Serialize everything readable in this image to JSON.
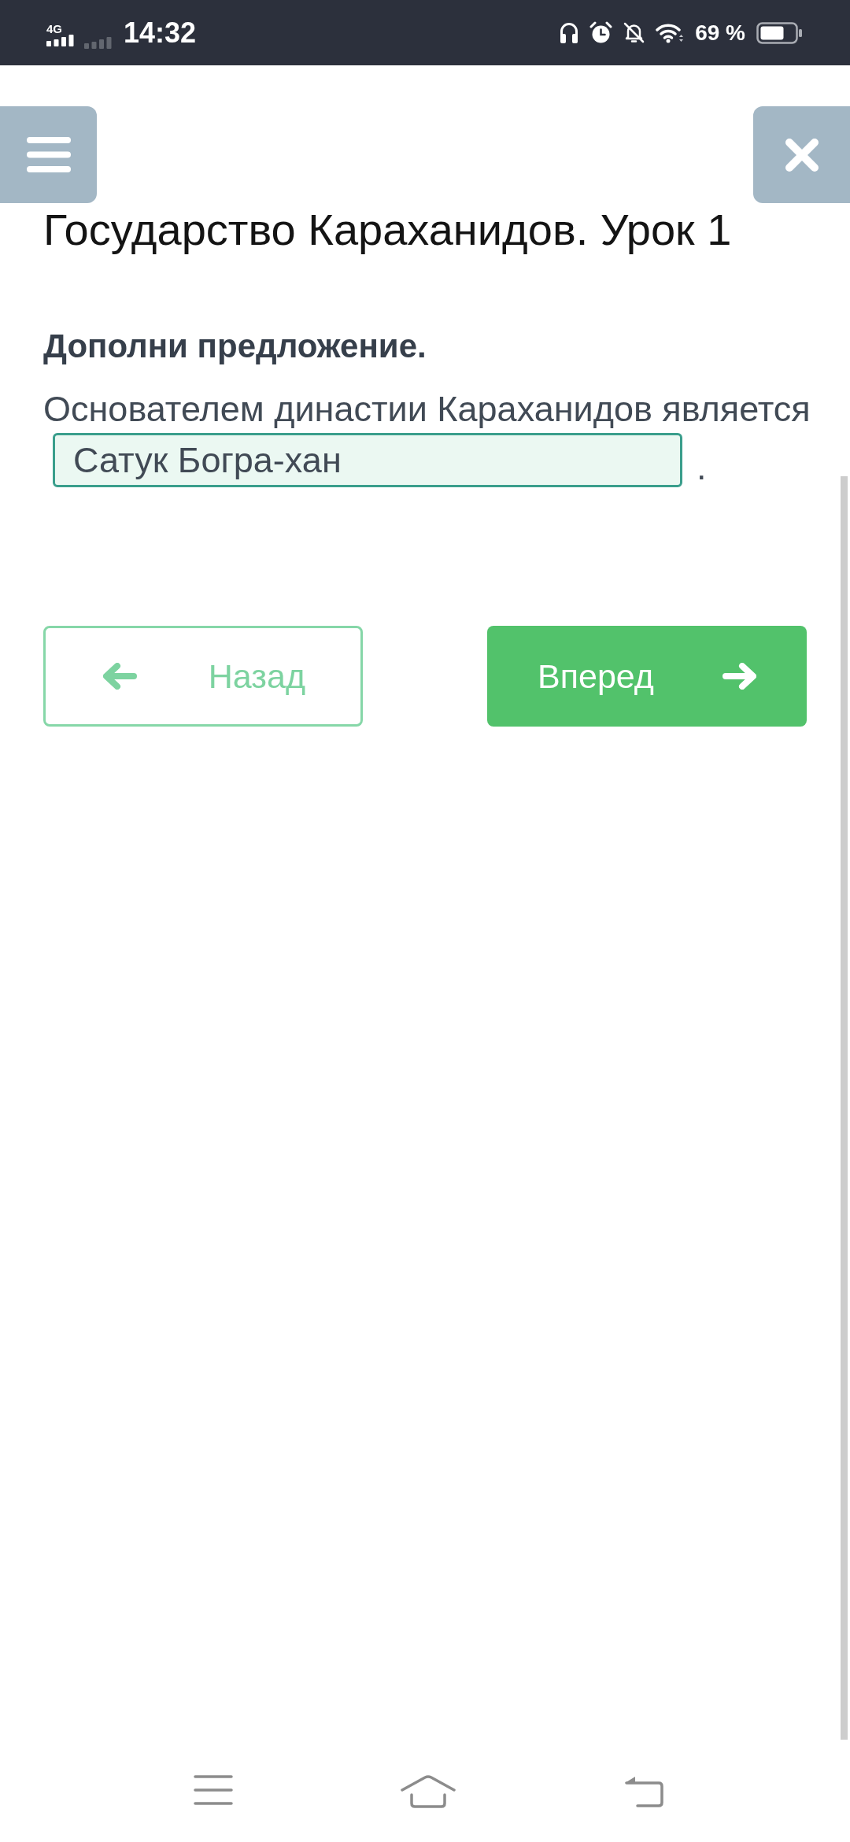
{
  "status_bar": {
    "network": "4G",
    "time": "14:32",
    "battery": "69 %"
  },
  "header": {
    "title": "Государство Караханидов. Урок 1"
  },
  "task": {
    "instruction": "Дополни предложение.",
    "sentence": "Основателем династии Караханидов является",
    "answer": {
      "value": "Сатук Богра-хан",
      "correct": true
    },
    "ending": "."
  },
  "buttons": [
    {
      "kind": "back",
      "label": "Назад"
    },
    {
      "kind": "forward",
      "label": "Вперед"
    }
  ]
}
